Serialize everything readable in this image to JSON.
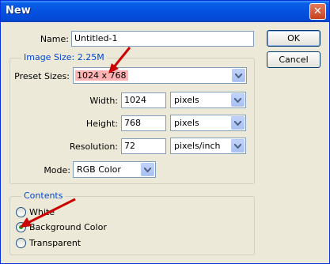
{
  "window": {
    "title": "New",
    "close_glyph": "✕"
  },
  "name": {
    "label": "Name:",
    "value": "Untitled-1"
  },
  "buttons": {
    "ok": "OK",
    "cancel": "Cancel"
  },
  "image_size": {
    "group_title": "Image Size: 2.25M",
    "preset": {
      "label": "Preset Sizes:",
      "value": "1024 x 768"
    },
    "width": {
      "label": "Width:",
      "value": "1024",
      "unit": "pixels"
    },
    "height": {
      "label": "Height:",
      "value": "768",
      "unit": "pixels"
    },
    "resolution": {
      "label": "Resolution:",
      "value": "72",
      "unit": "pixels/inch"
    },
    "mode": {
      "label": "Mode:",
      "value": "RGB Color"
    }
  },
  "contents": {
    "group_title": "Contents",
    "options": [
      {
        "label": "White",
        "selected": false
      },
      {
        "label": "Background Color",
        "selected": true
      },
      {
        "label": "Transparent",
        "selected": false
      }
    ]
  },
  "colors": {
    "titlebar": "#0452e0",
    "dialog_bg": "#ece9d8",
    "highlight": "#ffb3b3",
    "annotation_arrow": "#cc0000",
    "group_title": "#0046d5"
  }
}
